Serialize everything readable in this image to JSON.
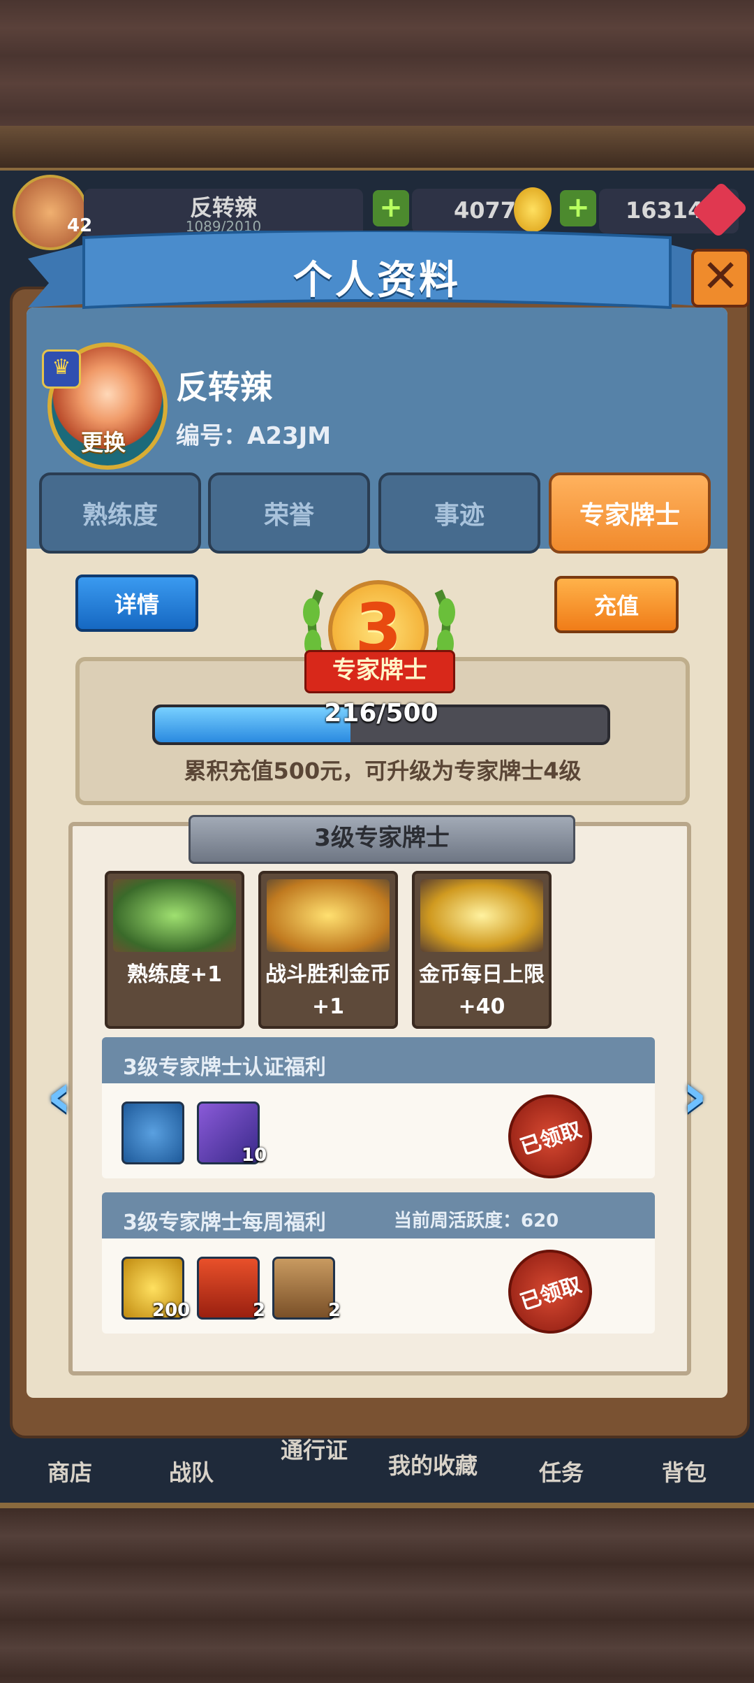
{
  "hud": {
    "name": "反转辣",
    "level": "42",
    "exp_text": "1089/2010",
    "coins": "4077",
    "gems": "16314"
  },
  "modal": {
    "title": "个人资料",
    "close_symbol": "✕"
  },
  "profile": {
    "name": "反转辣",
    "id_label": "编号：A23JM",
    "change_label": "更换"
  },
  "tabs": [
    {
      "label": "熟练度",
      "active": false
    },
    {
      "label": "荣誉",
      "active": false
    },
    {
      "label": "事迹",
      "active": false
    },
    {
      "label": "专家牌士",
      "active": true
    }
  ],
  "actions": {
    "detail_label": "详情",
    "recharge_label": "充值"
  },
  "expert": {
    "level": "3",
    "badge_label": "专家牌士",
    "progress_current": 216,
    "progress_max": 500,
    "progress_text": "216/500",
    "upgrade_hint": "累积充值500元，可升级为专家牌士4级"
  },
  "level_panel": {
    "title": "3级专家牌士",
    "perks": [
      {
        "label": "熟练度+1",
        "icon": "proficiency-up-icon"
      },
      {
        "label": "战斗胜利金币+1",
        "icon": "victory-coin-icon"
      },
      {
        "label": "金币每日上限+40",
        "icon": "gold-chest-icon"
      }
    ],
    "certification": {
      "title": "3级专家牌士认证福利",
      "items": [
        {
          "icon": "dragon-avatar-icon",
          "count": ""
        },
        {
          "icon": "card-pack-icon",
          "count": "10"
        }
      ],
      "stamp": "已领取"
    },
    "weekly": {
      "title": "3级专家牌士每周福利",
      "activity": "当前周活跃度：620",
      "items": [
        {
          "icon": "gold-coin-icon",
          "count": "200"
        },
        {
          "icon": "treasure-chest-icon",
          "count": "2"
        },
        {
          "icon": "card-bag-icon",
          "count": "2"
        }
      ],
      "stamp": "已领取"
    }
  },
  "bottom_nav": [
    {
      "label": "商店"
    },
    {
      "label": "战队"
    },
    {
      "label": "通行证"
    },
    {
      "label": "我的收藏"
    },
    {
      "label": "任务"
    },
    {
      "label": "背包"
    }
  ],
  "colors": {
    "blue_header": "#5682a8",
    "active_tab": "#f18a2c",
    "paper": "#f3ece0",
    "stamp_red": "#c0281a"
  }
}
